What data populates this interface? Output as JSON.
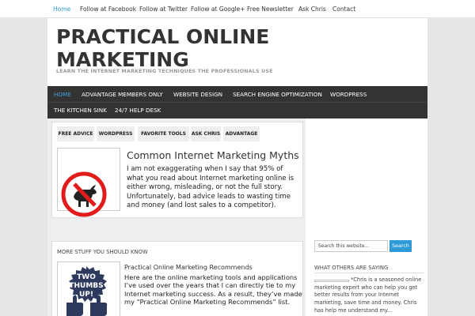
{
  "topbar": {
    "links": [
      "Home",
      "Follow at Facebook",
      "Follow at Twitter",
      "Follow at Google+",
      "Free Newsletter",
      "Ask Chris",
      "Contact"
    ]
  },
  "header": {
    "title": "PRACTICAL ONLINE MARKETING",
    "description": "LEARN THE INTERNET MARKETING TECHNIQUES THE PROFESSIONALS USE"
  },
  "nav": {
    "items": [
      "HOME",
      "ADVANTAGE MEMBERS ONLY",
      "WEBSITE DESIGN",
      "SEARCH ENGINE OPTIMIZATION",
      "WORDPRESS",
      "THE KITCHEN SINK",
      "24/7 HELP DESK"
    ]
  },
  "featured": {
    "tabs": [
      "FREE ADVICE",
      "WORDPRESS",
      "FAVORITE TOOLS",
      "ASK CHRIS",
      "ADVANTAGE"
    ],
    "post": {
      "title": "Common Internet Marketing Myths",
      "excerpt": "I am not exaggerating when I say that 95% of what you read about Internet marketing online is either wrong, misleading, or not the full story. Unfortunately, bad advice leads to wasting time and money (and lost sales to a competitor).",
      "icon": "no-bull-icon"
    }
  },
  "more": {
    "label": "MORE STUFF YOU SHOULD KNOW",
    "post": {
      "title": "Practical Online Marketing Recommends",
      "excerpt": "Here are the online marketing tools and applications I’ve used over the years that I can directly tie to my Internet marketing success. As a result, they’ve made my “Practical Online Marketing Recommends” list.",
      "thumb_text": [
        "TWO",
        "THUMBS",
        "UP!"
      ],
      "icon": "two-thumbs-up-icon"
    }
  },
  "sidebar": {
    "search_placeholder": "Search this website…",
    "search_button": "Search",
    "widget_title": "WHAT OTHERS ARE SAYING",
    "testimonial": "*Chris is a seasoned online marketing expert who can help you get better results from your Internet marketing, save time and money. Chris has help me understand my..."
  },
  "colors": {
    "accent": "#2f9bd6",
    "nav_bg": "#333333",
    "page_bg": "#e6e6e6"
  }
}
